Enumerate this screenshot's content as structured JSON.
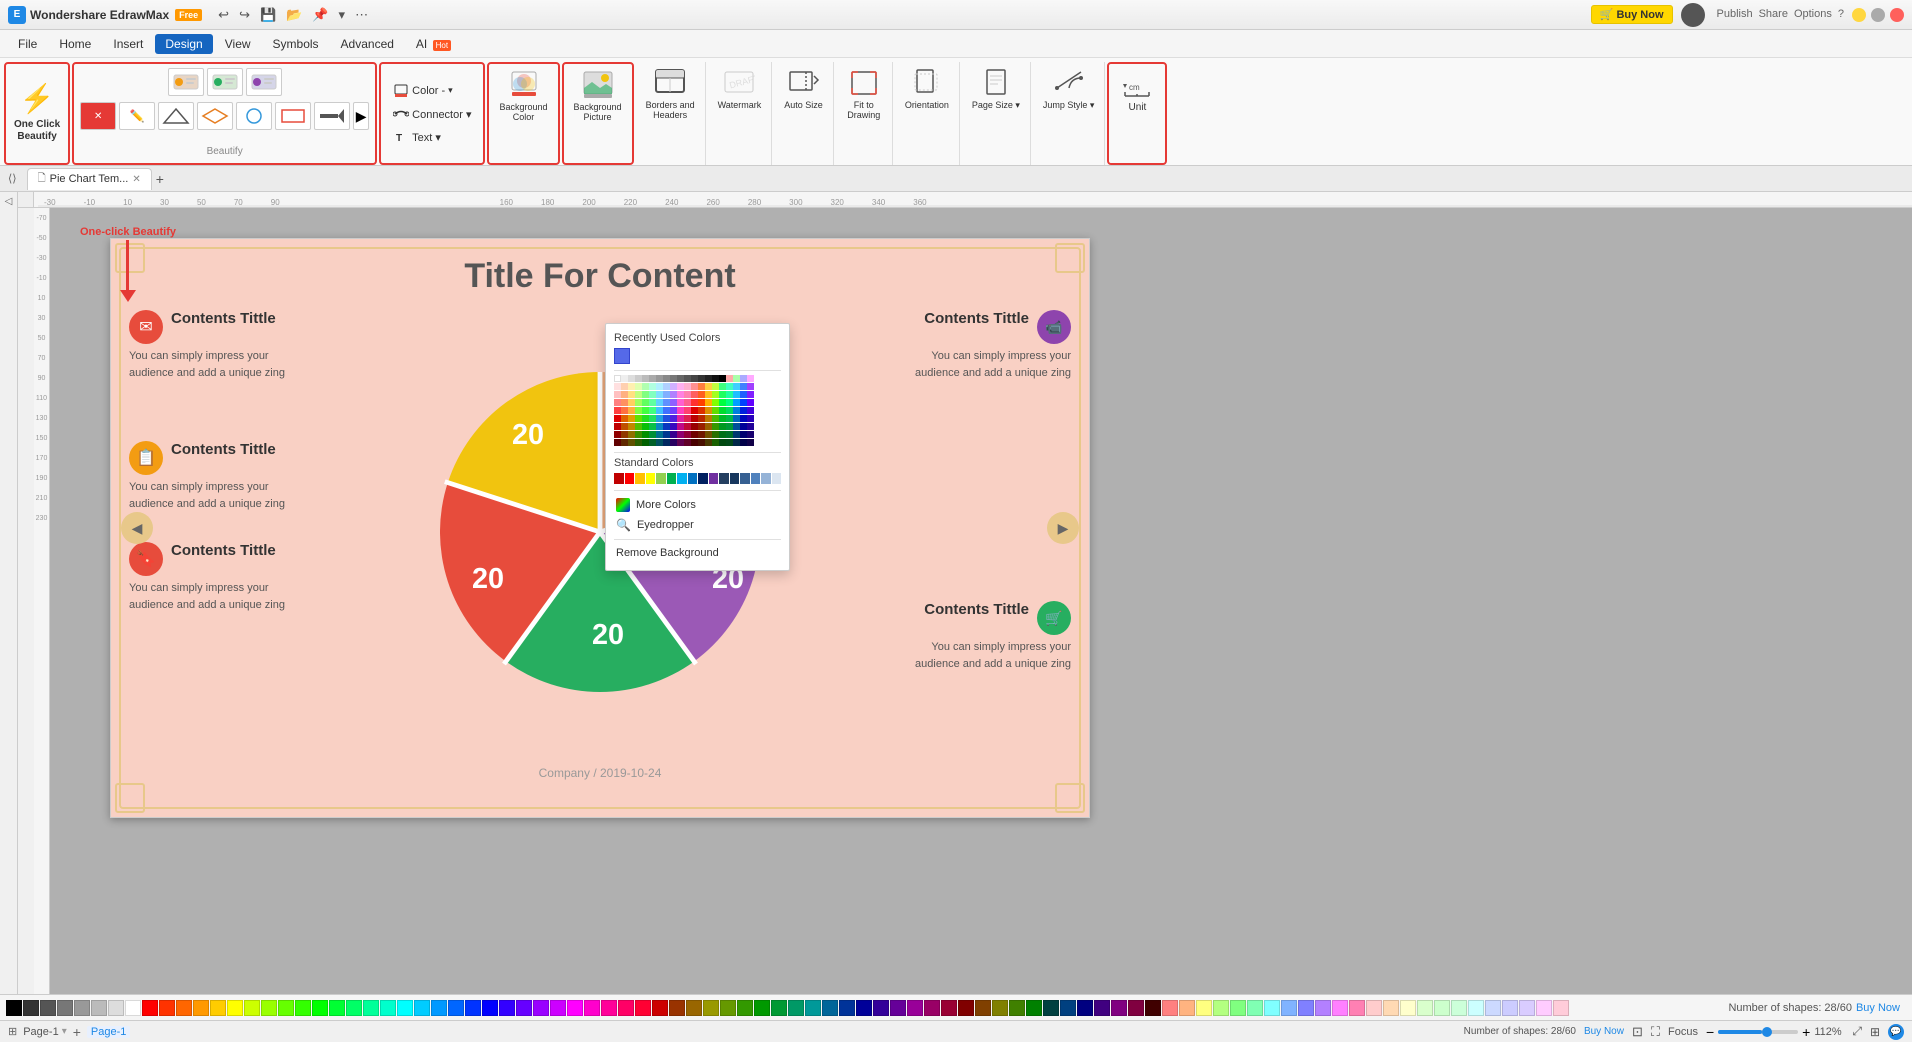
{
  "titleBar": {
    "appName": "Wondershare EdrawMax",
    "freeBadge": "Free",
    "buyNowLabel": "🛒 Buy Now",
    "undoIcon": "↩",
    "redoIcon": "↪",
    "saveIcon": "💾",
    "openIcon": "📂",
    "pinIcon": "📌",
    "dropIcon": "▾",
    "moreIcon": "⋯",
    "publishLabel": "Publish",
    "shareLabel": "Share",
    "optionsLabel": "Options",
    "helpIcon": "?"
  },
  "menuBar": {
    "items": [
      "File",
      "Home",
      "Insert",
      "Design",
      "View",
      "Symbols",
      "Advanced",
      "AI"
    ]
  },
  "ribbon": {
    "oneClickGroup": {
      "label": "One Click Beautify",
      "icon": "✨"
    },
    "beautifyGroup": {
      "label": "Beautify",
      "buttons": [
        "🎨",
        "🎯",
        "⚙️",
        "🗑️",
        "✏️",
        "🔷",
        "🔶",
        "🔵",
        "🔴",
        "🟤",
        "🟢",
        "🟡",
        "▶"
      ]
    },
    "colorGroup": {
      "label": "Color -",
      "colorIcon": "🎨",
      "connectorLabel": "Connector ▾",
      "textLabel": "Text ▾"
    },
    "bgColorGroup": {
      "label": "Background Color",
      "icon": "🎨",
      "dropArrow": "▾"
    },
    "bgPictureGroup": {
      "label": "Background Picture",
      "icon": "🖼️",
      "dropArrow": "▾"
    },
    "bordersGroup": {
      "label": "Borders and Headers",
      "icon": "📋",
      "dropArrow": "▾"
    },
    "watermarkGroup": {
      "label": "Watermark",
      "icon": "💧"
    },
    "autoSizeGroup": {
      "label": "Auto Size",
      "icon": "⬛"
    },
    "fitDrawingGroup": {
      "label": "Fit to Drawing",
      "icon": "🔲"
    },
    "orientationGroup": {
      "label": "Orientation",
      "icon": "📄"
    },
    "pageSizeGroup": {
      "label": "Page Size",
      "icon": "📏",
      "dropArrow": "▾"
    },
    "jumpStyleGroup": {
      "label": "Jump Style",
      "icon": "↗️",
      "dropArrow": "▾"
    },
    "unitGroup": {
      "label": "Unit",
      "icon": "📐"
    }
  },
  "tabs": {
    "items": [
      {
        "label": "Pie Chart Tem...",
        "active": true
      },
      {
        "label": "+",
        "isAdd": true
      }
    ],
    "pageLabel": "Page-1"
  },
  "colorDropdown": {
    "title": "Recently Used Colors",
    "recentColor": "#5569e8",
    "standardColorsTitle": "Standard Colors",
    "moreColorsLabel": "More Colors",
    "eyedropperLabel": "Eyedropper",
    "removeBackgroundLabel": "Remove Background"
  },
  "canvas": {
    "title": "Title For Content",
    "leftCards": [
      {
        "title": "Contents Tittle",
        "icon": "✉",
        "iconBg": "#e74c3c",
        "text": "You can simply impress your audience and add a unique zing"
      },
      {
        "title": "Contents Tittle",
        "icon": "📋",
        "iconBg": "#f39c12",
        "text": "You can simply impress your audience and add a unique zing"
      },
      {
        "title": "Contents Tittle",
        "icon": "🔖",
        "iconBg": "#e74c3c",
        "text": "You can simply impress your audience and add a unique zing"
      }
    ],
    "rightCards": [
      {
        "title": "Contents Tittle",
        "icon": "📹",
        "iconBg": "#8e44ad",
        "text": "You can simply impress your audience and add a unique zing"
      },
      {
        "title": "Contents Tittle",
        "icon": "🛒",
        "iconBg": "#27ae60",
        "text": "You can simply impress your audience and add a unique zing"
      }
    ],
    "companyDate": "Company / 2019-10-24",
    "pieValues": [
      "20",
      "20",
      "20",
      "20",
      "20"
    ],
    "pieColors": [
      "#e8a87c",
      "#9b59b6",
      "#27ae60",
      "#e74c3c",
      "#f1c40f"
    ]
  },
  "statusBar": {
    "pageLabel": "Page-1",
    "addPageIcon": "+",
    "shapesInfo": "Number of shapes: 28/60",
    "buyNowLabel": "Buy Now",
    "zoomLevel": "112%",
    "focusLabel": "Focus"
  },
  "annotation": {
    "arrowText": "One-click Beautify",
    "arrowColor": "#e53935"
  }
}
